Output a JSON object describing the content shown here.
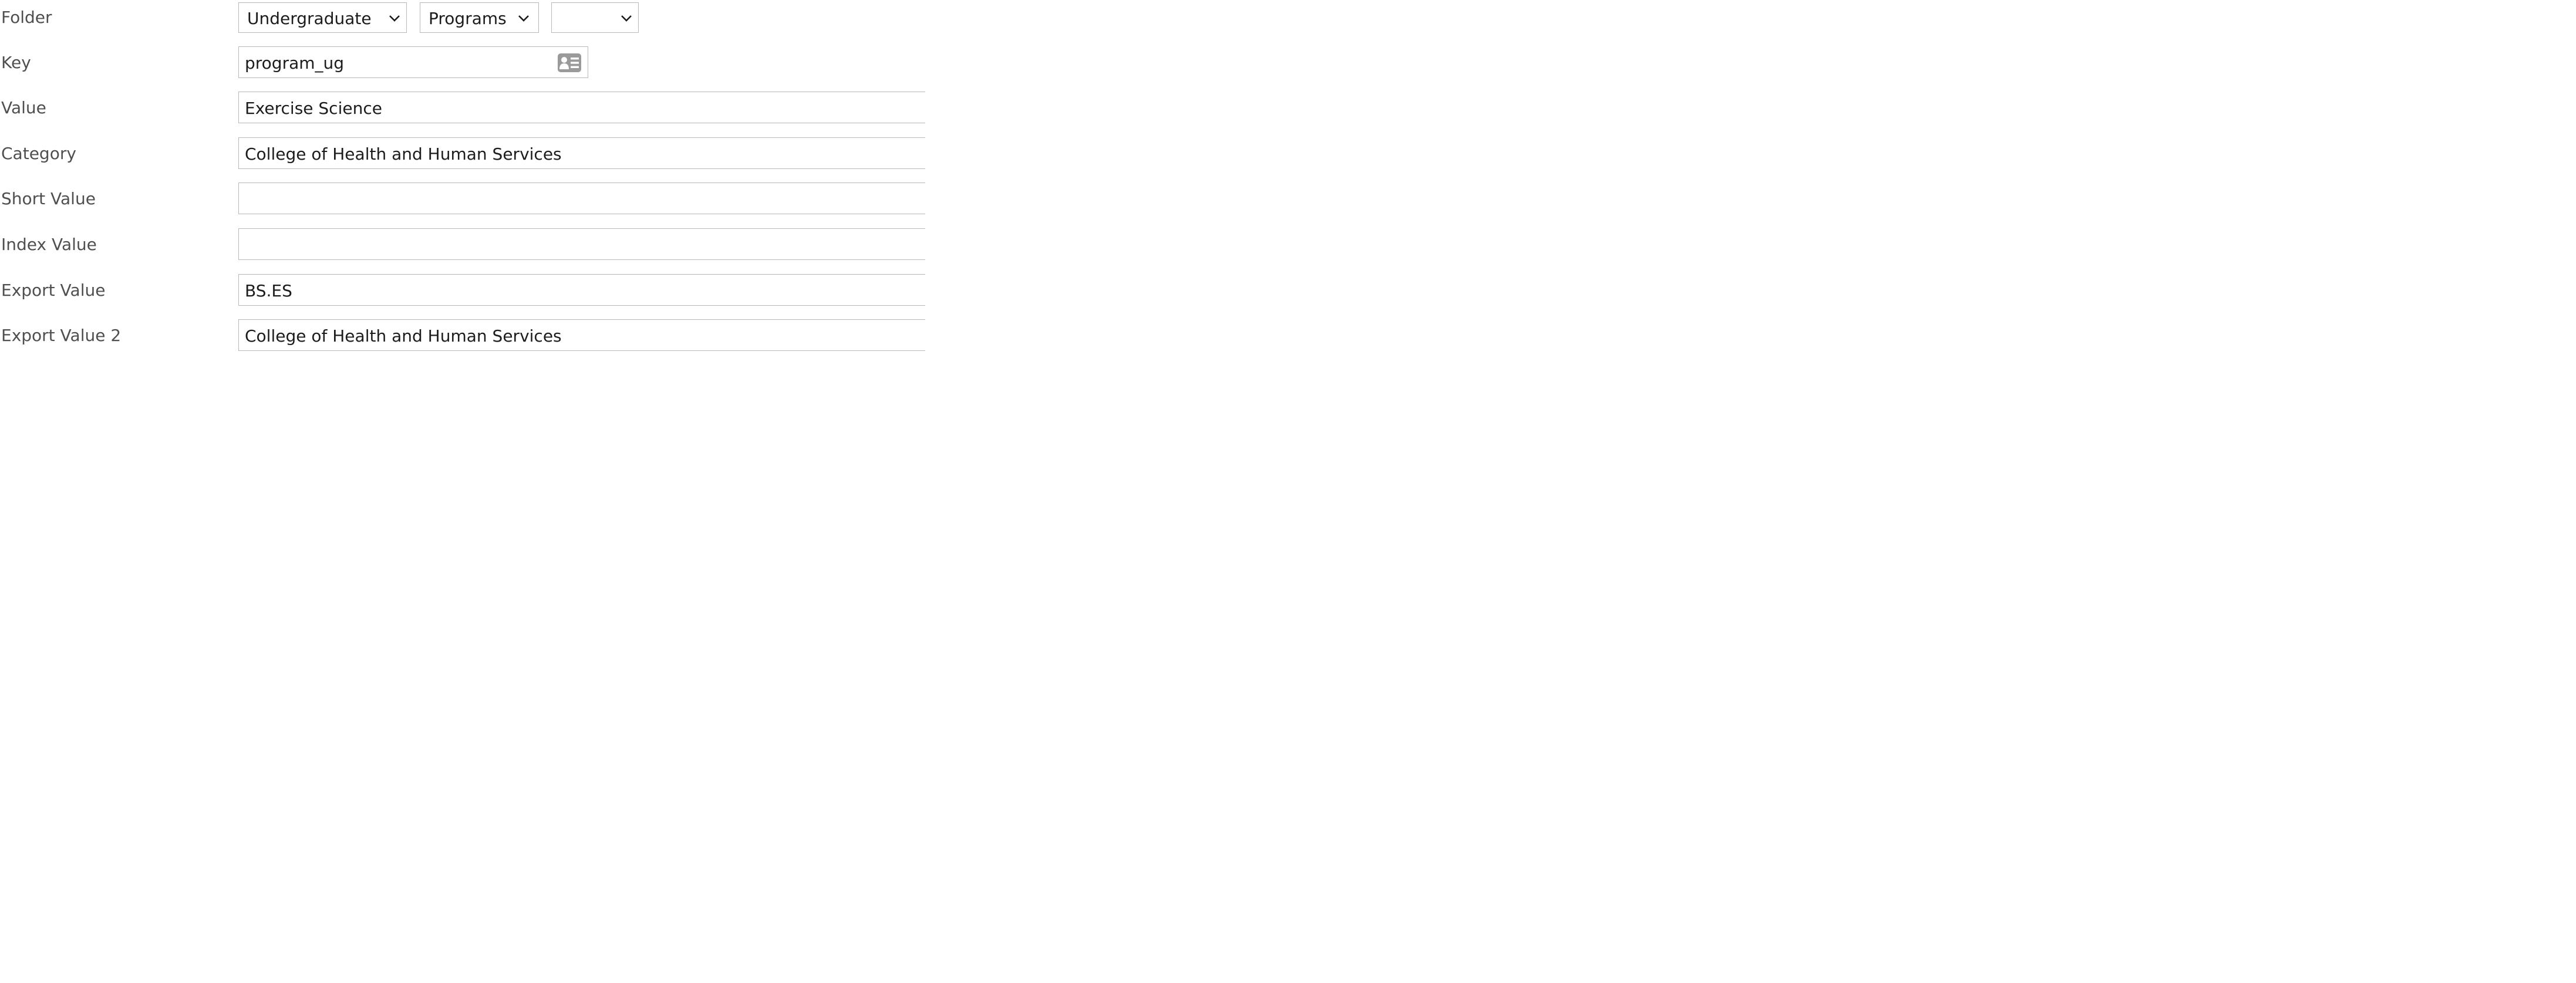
{
  "folder": {
    "label": "Folder",
    "selects": [
      {
        "value": "Undergraduate"
      },
      {
        "value": "Programs"
      },
      {
        "value": ""
      }
    ]
  },
  "key": {
    "label": "Key",
    "value": "program_ug",
    "icon": "id-card-icon"
  },
  "value": {
    "label": "Value",
    "value": "Exercise Science"
  },
  "category": {
    "label": "Category",
    "value": "College of Health and Human Services"
  },
  "short_value": {
    "label": "Short Value",
    "value": ""
  },
  "index_value": {
    "label": "Index Value",
    "value": ""
  },
  "export_value": {
    "label": "Export Value",
    "value": "BS.ES"
  },
  "export_value_2": {
    "label": "Export Value 2",
    "value": "College of Health and Human Services"
  },
  "colors": {
    "border": "#b9b9b9",
    "label": "#4f4f4f",
    "text": "#1c1c1c",
    "icon": "#9a9a9a"
  }
}
